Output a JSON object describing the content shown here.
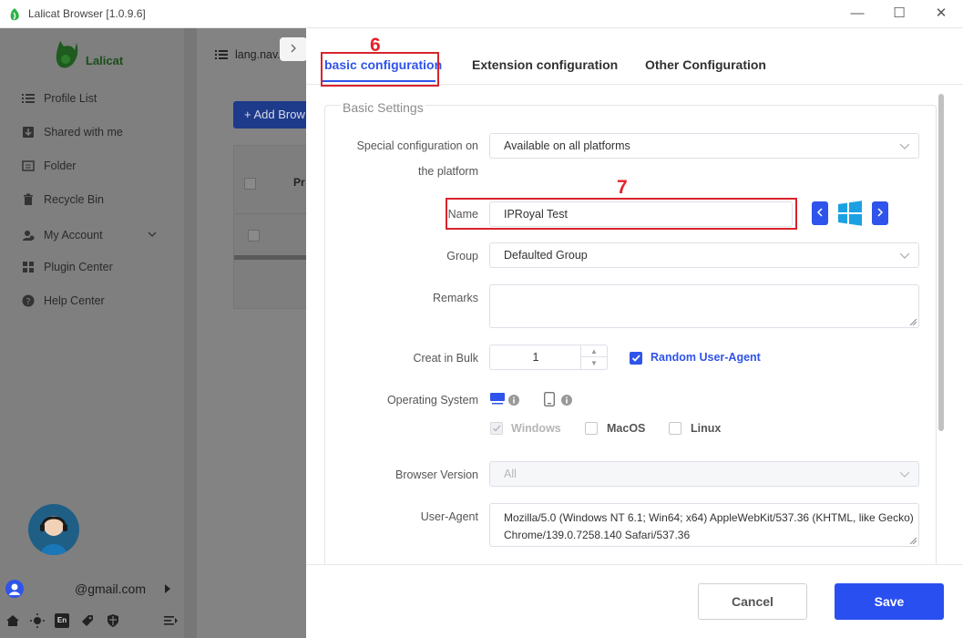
{
  "window": {
    "title": "Lalicat Browser  [1.0.9.6]",
    "minimize": "—",
    "maximize": "☐",
    "close": "✕"
  },
  "sidebar": {
    "logo_text": "Lalicat",
    "items": [
      {
        "label": "Profile List",
        "icon": "list-icon"
      },
      {
        "label": "Shared with me",
        "icon": "download-icon"
      },
      {
        "label": "Folder",
        "icon": "folder-icon"
      },
      {
        "label": "Recycle Bin",
        "icon": "trash-icon"
      },
      {
        "label": "My Account",
        "icon": "user-icon"
      },
      {
        "label": "Plugin Center",
        "icon": "plugin-icon"
      },
      {
        "label": "Help Center",
        "icon": "help-icon"
      }
    ],
    "account_email": "@gmail.com",
    "bottom_icons": [
      "home-icon",
      "theme-icon",
      "language-icon",
      "tag-icon",
      "shield-icon",
      "menu-icon"
    ],
    "language_badge": "En"
  },
  "background": {
    "tab_label": "lang.nav.",
    "add_button": "+ Add Brow",
    "column_header": "Pr"
  },
  "drawer": {
    "tabs": [
      {
        "label": "basic configuration",
        "active": true
      },
      {
        "label": "Extension configuration",
        "active": false
      },
      {
        "label": "Other Configuration",
        "active": false
      }
    ],
    "annotations": {
      "step6": "6",
      "step7": "7"
    },
    "section_title": "Basic Settings",
    "fields": {
      "platform_label_line1": "Special configuration on",
      "platform_label_line2": "the platform",
      "platform_value": "Available on all platforms",
      "name_label": "Name",
      "name_value": "IPRoyal Test",
      "group_label": "Group",
      "group_value": "Defaulted Group",
      "remarks_label": "Remarks",
      "remarks_value": "",
      "bulk_label": "Creat in Bulk",
      "bulk_value": "1",
      "random_ua_label": "Random User-Agent",
      "random_ua_checked": true,
      "os_label": "Operating System",
      "os_options": [
        {
          "label": "Windows",
          "checked": true,
          "disabled": true
        },
        {
          "label": "MacOS",
          "checked": false
        },
        {
          "label": "Linux",
          "checked": false
        }
      ],
      "browser_version_label": "Browser Version",
      "browser_version_placeholder": "All",
      "ua_label": "User-Agent",
      "ua_line1": "Mozilla/5.0 (Windows NT 6.1; Win64; x64) AppleWebKit/537.36 (KHTML, like Gecko)",
      "ua_line2": "Chrome/139.0.7258.140 Safari/537.36"
    },
    "footer": {
      "cancel": "Cancel",
      "save": "Save"
    },
    "colors": {
      "accent": "#2f54eb",
      "annotation_red": "#e5232b",
      "windows_logo": "#1ba1e2"
    }
  }
}
